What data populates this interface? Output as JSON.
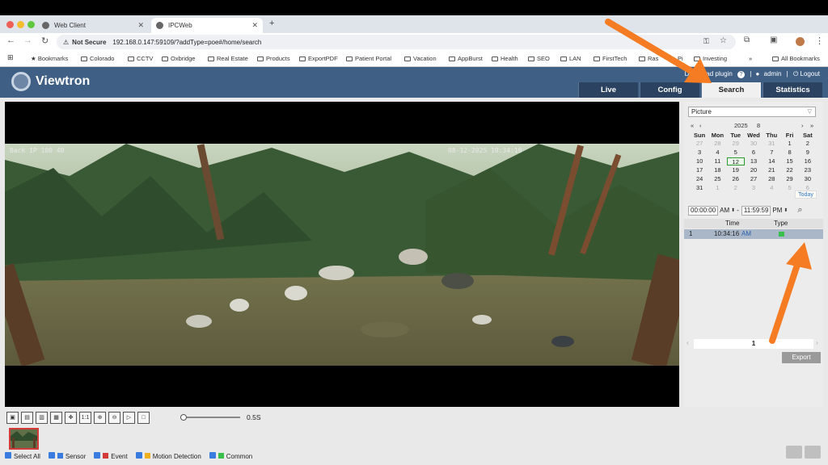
{
  "browser": {
    "tabs": [
      {
        "label": "Web Client"
      },
      {
        "label": "IPCWeb"
      }
    ],
    "security_label": "Not Secure",
    "url": "192.168.0.147:59109/?addType=poe#/home/search",
    "bookmarks": [
      "Bookmarks",
      "Colorado",
      "CCTV",
      "Oxbridge",
      "Real Estate",
      "Products",
      "ExportPDF",
      "Patient Portal",
      "Vacation",
      "AppBurst",
      "Health",
      "SEO",
      "LAN",
      "FirstTech",
      "Ras",
      "Pi",
      "Investing",
      "All Bookmarks"
    ]
  },
  "app": {
    "brand": "Viewtron",
    "download_plugin": "Download plugin",
    "user": "admin",
    "logout": "Logout",
    "nav": [
      "Live",
      "Config",
      "Search",
      "Statistics"
    ],
    "active_nav": "Search"
  },
  "video": {
    "camera_name": "Back IP 100 40",
    "timestamp": "08-12-2025 10:34:16"
  },
  "search_panel": {
    "type_value": "Picture",
    "year": "2025",
    "month": "8",
    "weekdays": [
      "Sun",
      "Mon",
      "Tue",
      "Wed",
      "Thu",
      "Fri",
      "Sat"
    ],
    "days": [
      [
        "27",
        "28",
        "29",
        "30",
        "31",
        "1",
        "2"
      ],
      [
        "3",
        "4",
        "5",
        "6",
        "7",
        "8",
        "9"
      ],
      [
        "10",
        "11",
        "12",
        "13",
        "14",
        "15",
        "16"
      ],
      [
        "17",
        "18",
        "19",
        "20",
        "21",
        "22",
        "23"
      ],
      [
        "24",
        "25",
        "26",
        "27",
        "28",
        "29",
        "30"
      ],
      [
        "31",
        "1",
        "2",
        "3",
        "4",
        "5",
        "6"
      ]
    ],
    "selected_day": "12",
    "today_label": "Today",
    "start_time": "00:00:00",
    "start_ampm": "AM",
    "end_time": "11:59:59",
    "end_ampm": "PM",
    "results_headers": [
      "Time",
      "Type"
    ],
    "results": [
      {
        "index": "1",
        "time": "10:34:16",
        "ampm": "AM"
      }
    ],
    "page": "1",
    "export_label": "Export"
  },
  "playback": {
    "speed": "0.5S",
    "buttons": [
      "snapshot",
      "record",
      "record-all",
      "snapshot-all",
      "fullscreen",
      "1:1",
      "zoom-in",
      "zoom-out",
      "play",
      "stop"
    ]
  },
  "legend": [
    {
      "label": "Select All",
      "color": "#3a7be0"
    },
    {
      "label": "Sensor",
      "color": "#3a7be0"
    },
    {
      "label": "Event",
      "color": "#d43a3a"
    },
    {
      "label": "Motion Detection",
      "color": "#f0b020"
    },
    {
      "label": "Common",
      "color": "#39c04a"
    }
  ],
  "colors": {
    "header": "#3f5f85",
    "nav_tab": "#2b4261",
    "arrow": "#f57c22"
  }
}
